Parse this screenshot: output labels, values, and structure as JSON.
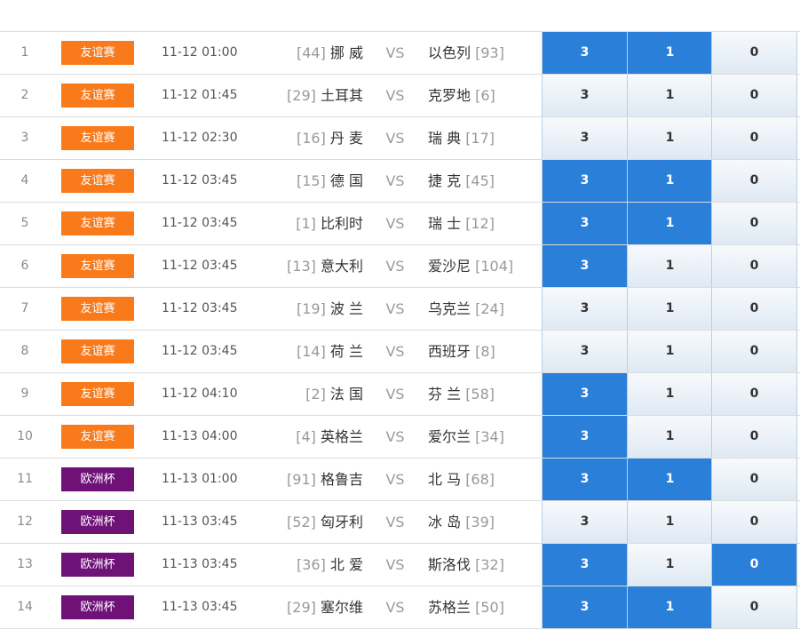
{
  "colors": {
    "friendly_badge": "#f97a1b",
    "euro_badge": "#6e1278",
    "selected_option": "#2a7fd9",
    "option_gradient_top": "#f7fafd",
    "option_gradient_bottom": "#dfe9f3"
  },
  "vs_label": "VS",
  "matches": [
    {
      "index": "1",
      "league": "友谊赛",
      "league_type": "friendly",
      "time": "11-12 01:00",
      "home_rank": "[44]",
      "home": "挪 威",
      "away": "以色列",
      "away_rank": "[93]",
      "options": [
        "3",
        "1",
        "0"
      ],
      "selected": [
        true,
        true,
        false
      ]
    },
    {
      "index": "2",
      "league": "友谊赛",
      "league_type": "friendly",
      "time": "11-12 01:45",
      "home_rank": "[29]",
      "home": "土耳其",
      "away": "克罗地",
      "away_rank": "[6]",
      "options": [
        "3",
        "1",
        "0"
      ],
      "selected": [
        false,
        false,
        false
      ]
    },
    {
      "index": "3",
      "league": "友谊赛",
      "league_type": "friendly",
      "time": "11-12 02:30",
      "home_rank": "[16]",
      "home": "丹 麦",
      "away": "瑞 典",
      "away_rank": "[17]",
      "options": [
        "3",
        "1",
        "0"
      ],
      "selected": [
        false,
        false,
        false
      ]
    },
    {
      "index": "4",
      "league": "友谊赛",
      "league_type": "friendly",
      "time": "11-12 03:45",
      "home_rank": "[15]",
      "home": "德 国",
      "away": "捷 克",
      "away_rank": "[45]",
      "options": [
        "3",
        "1",
        "0"
      ],
      "selected": [
        true,
        true,
        false
      ]
    },
    {
      "index": "5",
      "league": "友谊赛",
      "league_type": "friendly",
      "time": "11-12 03:45",
      "home_rank": "[1]",
      "home": "比利时",
      "away": "瑞 士",
      "away_rank": "[12]",
      "options": [
        "3",
        "1",
        "0"
      ],
      "selected": [
        true,
        true,
        false
      ]
    },
    {
      "index": "6",
      "league": "友谊赛",
      "league_type": "friendly",
      "time": "11-12 03:45",
      "home_rank": "[13]",
      "home": "意大利",
      "away": "爱沙尼",
      "away_rank": "[104]",
      "options": [
        "3",
        "1",
        "0"
      ],
      "selected": [
        true,
        false,
        false
      ]
    },
    {
      "index": "7",
      "league": "友谊赛",
      "league_type": "friendly",
      "time": "11-12 03:45",
      "home_rank": "[19]",
      "home": "波 兰",
      "away": "乌克兰",
      "away_rank": "[24]",
      "options": [
        "3",
        "1",
        "0"
      ],
      "selected": [
        false,
        false,
        false
      ]
    },
    {
      "index": "8",
      "league": "友谊赛",
      "league_type": "friendly",
      "time": "11-12 03:45",
      "home_rank": "[14]",
      "home": "荷 兰",
      "away": "西班牙",
      "away_rank": "[8]",
      "options": [
        "3",
        "1",
        "0"
      ],
      "selected": [
        false,
        false,
        false
      ]
    },
    {
      "index": "9",
      "league": "友谊赛",
      "league_type": "friendly",
      "time": "11-12 04:10",
      "home_rank": "[2]",
      "home": "法 国",
      "away": "芬 兰",
      "away_rank": "[58]",
      "options": [
        "3",
        "1",
        "0"
      ],
      "selected": [
        true,
        false,
        false
      ]
    },
    {
      "index": "10",
      "league": "友谊赛",
      "league_type": "friendly",
      "time": "11-13 04:00",
      "home_rank": "[4]",
      "home": "英格兰",
      "away": "爱尔兰",
      "away_rank": "[34]",
      "options": [
        "3",
        "1",
        "0"
      ],
      "selected": [
        true,
        false,
        false
      ]
    },
    {
      "index": "11",
      "league": "欧洲杯",
      "league_type": "euro",
      "time": "11-13 01:00",
      "home_rank": "[91]",
      "home": "格鲁吉",
      "away": "北 马",
      "away_rank": "[68]",
      "options": [
        "3",
        "1",
        "0"
      ],
      "selected": [
        true,
        true,
        false
      ]
    },
    {
      "index": "12",
      "league": "欧洲杯",
      "league_type": "euro",
      "time": "11-13 03:45",
      "home_rank": "[52]",
      "home": "匈牙利",
      "away": "冰 岛",
      "away_rank": "[39]",
      "options": [
        "3",
        "1",
        "0"
      ],
      "selected": [
        false,
        false,
        false
      ]
    },
    {
      "index": "13",
      "league": "欧洲杯",
      "league_type": "euro",
      "time": "11-13 03:45",
      "home_rank": "[36]",
      "home": "北 爱",
      "away": "斯洛伐",
      "away_rank": "[32]",
      "options": [
        "3",
        "1",
        "0"
      ],
      "selected": [
        true,
        false,
        true
      ]
    },
    {
      "index": "14",
      "league": "欧洲杯",
      "league_type": "euro",
      "time": "11-13 03:45",
      "home_rank": "[29]",
      "home": "塞尔维",
      "away": "苏格兰",
      "away_rank": "[50]",
      "options": [
        "3",
        "1",
        "0"
      ],
      "selected": [
        true,
        true,
        false
      ]
    }
  ]
}
